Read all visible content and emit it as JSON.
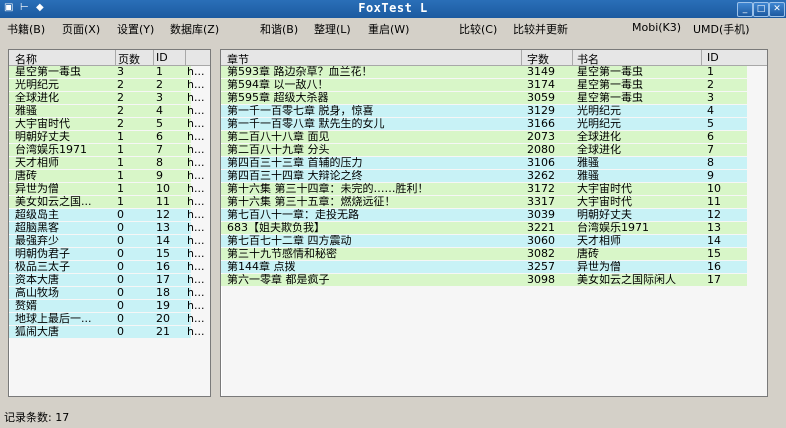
{
  "window": {
    "title": "FoxTest L",
    "sys_icons": [
      "▣",
      "⊢",
      "◆"
    ]
  },
  "menu": [
    "书籍(B)",
    "页面(X)",
    "设置(Y)",
    "数据库(Z)",
    "和谐(B)",
    "整理(L)",
    "重启(W)",
    "比较(C)",
    "比较并更新",
    "Mobi(K3)",
    "UMD(手机)"
  ],
  "left_table": {
    "headers": [
      "名称",
      "页数",
      "ID",
      ""
    ],
    "rows": [
      {
        "name": "星空第一毒虫",
        "pages": "3",
        "id": "1",
        "extra": "h...",
        "tone": "green"
      },
      {
        "name": "光明纪元",
        "pages": "2",
        "id": "2",
        "extra": "h...",
        "tone": "green"
      },
      {
        "name": "全球进化",
        "pages": "2",
        "id": "3",
        "extra": "h...",
        "tone": "green"
      },
      {
        "name": "雅骚",
        "pages": "2",
        "id": "4",
        "extra": "h...",
        "tone": "green"
      },
      {
        "name": "大宇宙时代",
        "pages": "2",
        "id": "5",
        "extra": "h...",
        "tone": "green"
      },
      {
        "name": "明朝好丈夫",
        "pages": "1",
        "id": "6",
        "extra": "h...",
        "tone": "green"
      },
      {
        "name": "台湾娱乐1971",
        "pages": "1",
        "id": "7",
        "extra": "h...",
        "tone": "green"
      },
      {
        "name": "天才相师",
        "pages": "1",
        "id": "8",
        "extra": "h...",
        "tone": "green"
      },
      {
        "name": "唐砖",
        "pages": "1",
        "id": "9",
        "extra": "h...",
        "tone": "green"
      },
      {
        "name": "异世为僧",
        "pages": "1",
        "id": "10",
        "extra": "h...",
        "tone": "green"
      },
      {
        "name": "美女如云之国...",
        "pages": "1",
        "id": "11",
        "extra": "h...",
        "tone": "green"
      },
      {
        "name": "超级岛主",
        "pages": "0",
        "id": "12",
        "extra": "h...",
        "tone": "cyan"
      },
      {
        "name": "超脑黑客",
        "pages": "0",
        "id": "13",
        "extra": "h...",
        "tone": "cyan"
      },
      {
        "name": "最强弃少",
        "pages": "0",
        "id": "14",
        "extra": "h...",
        "tone": "cyan"
      },
      {
        "name": "明朝伪君子",
        "pages": "0",
        "id": "15",
        "extra": "h...",
        "tone": "cyan"
      },
      {
        "name": "极品三太子",
        "pages": "0",
        "id": "16",
        "extra": "h...",
        "tone": "cyan"
      },
      {
        "name": "资本大唐",
        "pages": "0",
        "id": "17",
        "extra": "h...",
        "tone": "cyan"
      },
      {
        "name": "高山牧场",
        "pages": "0",
        "id": "18",
        "extra": "h...",
        "tone": "cyan"
      },
      {
        "name": "赘婿",
        "pages": "0",
        "id": "19",
        "extra": "h...",
        "tone": "cyan"
      },
      {
        "name": "地球上最后一...",
        "pages": "0",
        "id": "20",
        "extra": "h...",
        "tone": "cyan"
      },
      {
        "name": "狐闹大唐",
        "pages": "0",
        "id": "21",
        "extra": "h...",
        "tone": "cyan"
      }
    ]
  },
  "right_table": {
    "headers": [
      "章节",
      "字数",
      "书名",
      "ID"
    ],
    "rows": [
      {
        "chapter": "第593章 路边杂草？血兰花！",
        "words": "3149",
        "book": "星空第一毒虫",
        "id": "1",
        "tone": "green"
      },
      {
        "chapter": "第594章 以一敌八！",
        "words": "3174",
        "book": "星空第一毒虫",
        "id": "2",
        "tone": "green"
      },
      {
        "chapter": "第595章 超级大杀器",
        "words": "3059",
        "book": "星空第一毒虫",
        "id": "3",
        "tone": "green"
      },
      {
        "chapter": "第一千一百零七章 脱身，惊喜",
        "words": "3129",
        "book": "光明纪元",
        "id": "4",
        "tone": "cyan"
      },
      {
        "chapter": "第一千一百零八章 默先生的女儿",
        "words": "3166",
        "book": "光明纪元",
        "id": "5",
        "tone": "cyan"
      },
      {
        "chapter": "第二百八十八章 面见",
        "words": "2073",
        "book": "全球进化",
        "id": "6",
        "tone": "green"
      },
      {
        "chapter": "第二百八十九章 分头",
        "words": "2080",
        "book": "全球进化",
        "id": "7",
        "tone": "green"
      },
      {
        "chapter": "第四百三十三章 首辅的压力",
        "words": "3106",
        "book": "雅骚",
        "id": "8",
        "tone": "cyan"
      },
      {
        "chapter": "第四百三十四章 大辩论之终",
        "words": "3262",
        "book": "雅骚",
        "id": "9",
        "tone": "cyan"
      },
      {
        "chapter": "第十六集 第三十四章：未完的……胜利！",
        "words": "3172",
        "book": "大宇宙时代",
        "id": "10",
        "tone": "green"
      },
      {
        "chapter": "第十六集 第三十五章：燃烧远征！",
        "words": "3317",
        "book": "大宇宙时代",
        "id": "11",
        "tone": "green"
      },
      {
        "chapter": "第七百八十一章：走投无路",
        "words": "3039",
        "book": "明朝好丈夫",
        "id": "12",
        "tone": "cyan"
      },
      {
        "chapter": "683【姐夫欺负我】",
        "words": "3221",
        "book": "台湾娱乐1971",
        "id": "13",
        "tone": "green"
      },
      {
        "chapter": "第七百七十二章 四方震动",
        "words": "3060",
        "book": "天才相师",
        "id": "14",
        "tone": "cyan"
      },
      {
        "chapter": "第三十九节感情和秘密",
        "words": "3082",
        "book": "唐砖",
        "id": "15",
        "tone": "green"
      },
      {
        "chapter": "第144章 点拨",
        "words": "3257",
        "book": "异世为僧",
        "id": "16",
        "tone": "cyan"
      },
      {
        "chapter": "第六一零章 都是疯子",
        "words": "3098",
        "book": "美女如云之国际闲人",
        "id": "17",
        "tone": "green"
      }
    ]
  },
  "status": {
    "record_count": "记录条数: 17"
  }
}
